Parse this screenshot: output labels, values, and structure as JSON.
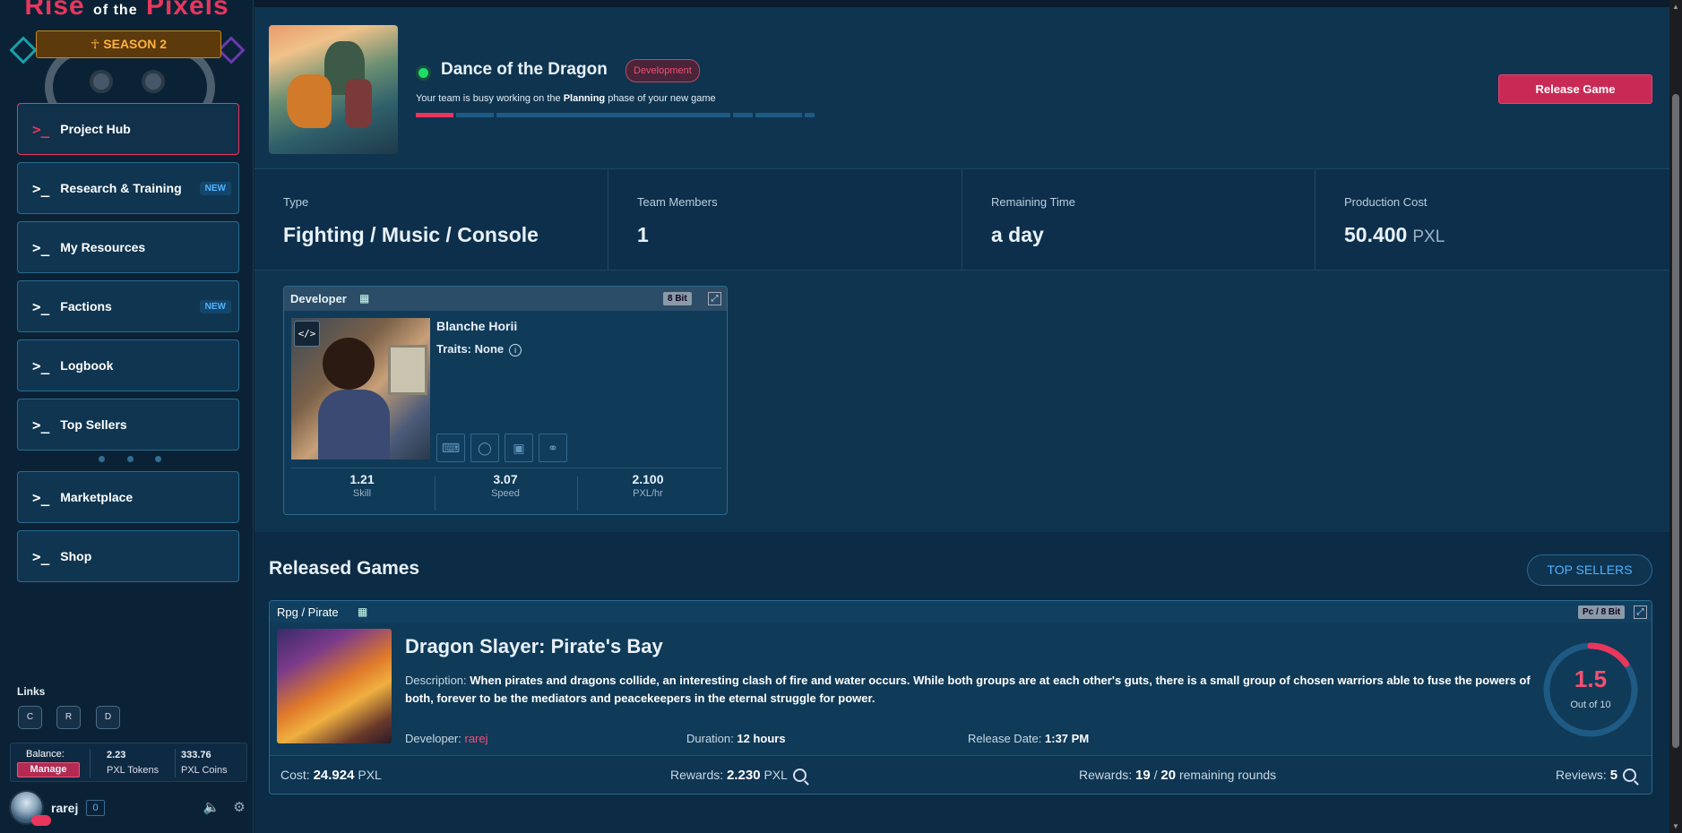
{
  "app": {
    "logo_text_1": "Rise",
    "logo_text_2": "of the",
    "logo_text_3": "Pixels",
    "season_label": "SEASON 2",
    "accent_color": "#e8365d",
    "link_color": "#4fb3ff"
  },
  "sidebar": {
    "items": [
      {
        "prompt": ">_",
        "label": "Project Hub",
        "active": true
      },
      {
        "prompt": ">_",
        "label": "Research & Training",
        "badge": "NEW"
      },
      {
        "prompt": ">_",
        "label": "My Resources"
      },
      {
        "prompt": ">_",
        "label": "Factions",
        "badge": "NEW"
      },
      {
        "prompt": ">_",
        "label": "Logbook"
      },
      {
        "prompt": ">_",
        "label": "Top Sellers"
      },
      {
        "prompt": ">_",
        "label": "Marketplace"
      },
      {
        "prompt": ">_",
        "label": "Shop"
      }
    ],
    "links_label": "Links",
    "links": [
      "C",
      "R",
      "D"
    ],
    "balance": {
      "label": "Balance:",
      "manage_label": "Manage",
      "tokens_value": "2.23",
      "tokens_unit": "PXL Tokens",
      "coins_value": "333.76",
      "coins_unit": "PXL Coins"
    },
    "user": {
      "name": "rarej",
      "level": "0"
    }
  },
  "project": {
    "title": "Dance of the Dragon",
    "status_badge": "Development",
    "subtitle_pre": "Your team is busy working on the ",
    "subtitle_phase": "Planning",
    "subtitle_post": " phase of your new game",
    "release_label": "Release Game",
    "stats": [
      {
        "label": "Type",
        "value": "Fighting / Music / Console"
      },
      {
        "label": "Team Members",
        "value": "1"
      },
      {
        "label": "Remaining Time",
        "value": "a day"
      },
      {
        "label": "Production Cost",
        "value": "50.400",
        "unit": "PXL"
      }
    ]
  },
  "developer": {
    "header": "Developer",
    "tier_badge": "8 Bit",
    "name": "Blanche Horii",
    "traits": "Traits: None",
    "code_icon_text": "</>",
    "tools": [
      "keyboard-icon",
      "mouse-icon",
      "monitor-icon",
      "headphones-icon"
    ],
    "stats": [
      {
        "value": "1.21",
        "label": "Skill"
      },
      {
        "value": "3.07",
        "label": "Speed"
      },
      {
        "value": "2.100",
        "label": "PXL/hr"
      }
    ]
  },
  "released": {
    "title": "Released Games",
    "top_sellers_label": "TOP SELLERS",
    "games": [
      {
        "genre": "Rpg / Pirate",
        "platform": "Pc / 8 Bit",
        "title": "Dragon Slayer: Pirate's Bay",
        "description_label": "Description:",
        "description": "When pirates and dragons collide, an interesting clash of fire and water occurs. While both groups are at each other's guts, there is a small group of chosen warriors able to fuse the powers of both, forever to be the mediators and peacekeepers in the eternal struggle for power.",
        "developer_label": "Developer:",
        "developer": "rarej",
        "duration_label": "Duration:",
        "duration": "12 hours",
        "release_label": "Release Date:",
        "release_date": "1:37 PM",
        "rating": "1.5",
        "rating_fraction": 0.15,
        "rating_sub": "Out of 10",
        "cost_label": "Cost:",
        "cost": "24.924",
        "cost_unit": "PXL",
        "rewards_label": "Rewards:",
        "rewards": "2.230",
        "rewards_unit": "PXL",
        "rounds_label": "Rewards:",
        "rounds_done": "19",
        "rounds_sep": "/",
        "rounds_total": "20",
        "rounds_suffix": "remaining rounds",
        "reviews_label": "Reviews:",
        "reviews": "5"
      }
    ]
  }
}
